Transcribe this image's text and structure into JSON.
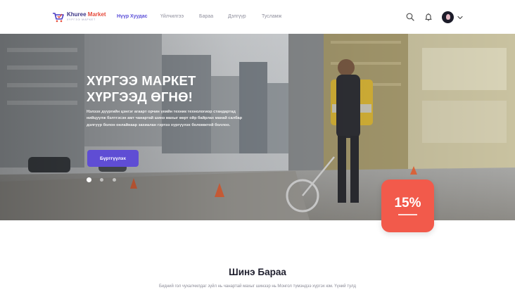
{
  "header": {
    "logo": {
      "name_part1": "Khuree",
      "name_part2": " Market",
      "tagline": "ХҮРГЭЭ МАРКЕТ"
    },
    "nav": [
      {
        "label": "Нүүр Хуудас",
        "active": true
      },
      {
        "label": "Үйлчилгээ",
        "active": false
      },
      {
        "label": "Бараа",
        "active": false
      },
      {
        "label": "Дэлгүүр",
        "active": false
      },
      {
        "label": "Тусламж",
        "active": false
      }
    ],
    "icons": [
      "search-icon",
      "bell-icon",
      "avatar",
      "chevron-down-icon"
    ]
  },
  "hero": {
    "title_line1": "ХҮРГЭЭ МАРКЕТ",
    "title_line2": "ХҮРГЭЭД ӨГНӨ!",
    "description": "Нэлээх дүүргийн цэнгэг агаарт орчин үеийн техник технологиор стандартад нийцүүлж бэлтгэсэн амт чанартай шинэ махыг өөрт ойр байрлах манай салбар дэлгүүр болон онлайнаар захиалан гэртээ хүргүүлэх боломжтой боллоо.",
    "button_label": "Бүртгүүлэх",
    "slides": 3,
    "active_slide": 1,
    "discount": "15%"
  },
  "section": {
    "title": "Шинэ Бараа",
    "description": "Бидний гол чухалчилдаг зүйл нь чанартай махыг шинээр нь Монгол түмэндээ хүргэх юм. Үүний тулд"
  },
  "colors": {
    "accent": "#5f4dd4",
    "discount": "#f25a4b",
    "nav_active": "#5b4fd8"
  }
}
